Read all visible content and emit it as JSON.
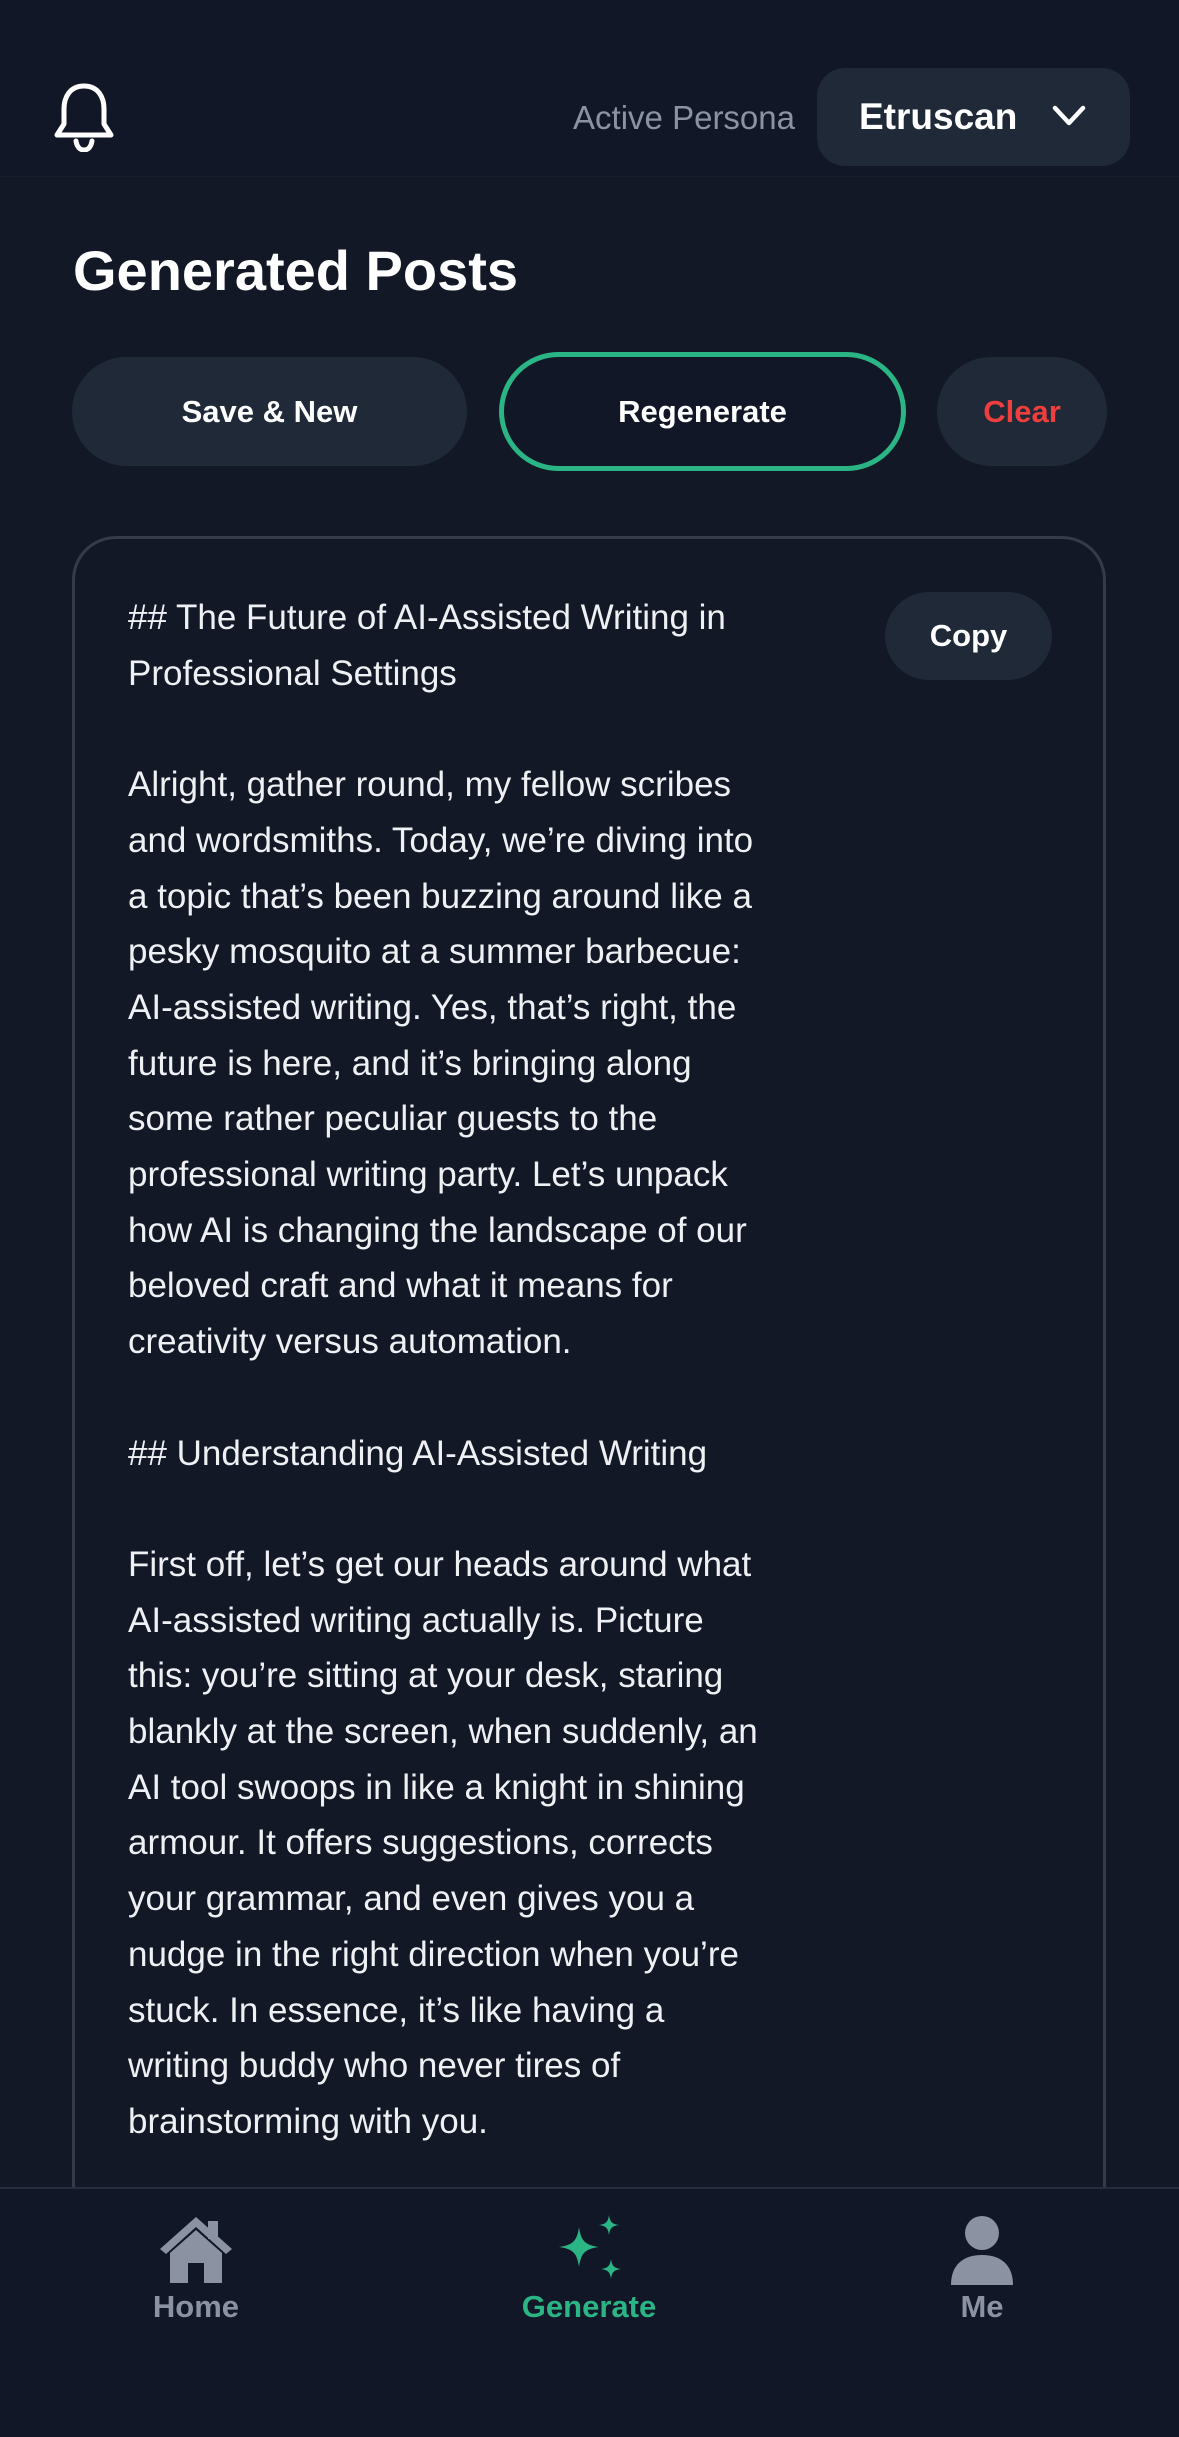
{
  "header": {
    "persona_label": "Active Persona",
    "persona_value": "Etruscan"
  },
  "page": {
    "title": "Generated Posts"
  },
  "actions": {
    "save_new": "Save & New",
    "regenerate": "Regenerate",
    "clear": "Clear"
  },
  "post": {
    "copy_label": "Copy",
    "body": "## The Future of AI-Assisted Writing in\nProfessional Settings\n\nAlright, gather round, my fellow scribes\nand wordsmiths. Today, we’re diving into\na topic that’s been buzzing around like a\npesky mosquito at a summer barbecue:\nAI-assisted writing. Yes, that’s right, the\nfuture is here, and it’s bringing along\nsome rather peculiar guests to the\nprofessional writing party. Let’s unpack\nhow AI is changing the landscape of our\nbeloved craft and what it means for\ncreativity versus automation.\n\n## Understanding AI-Assisted Writing\n\nFirst off, let’s get our heads around what\nAI-assisted writing actually is. Picture\nthis: you’re sitting at your desk, staring\nblankly at the screen, when suddenly, an\nAI tool swoops in like a knight in shining\narmour. It offers suggestions, corrects\nyour grammar, and even gives you a\nnudge in the right direction when you’re\nstuck. In essence, it’s like having a\nwriting buddy who never tires of\nbrainstorming with you."
  },
  "nav": {
    "home": "Home",
    "generate": "Generate",
    "me": "Me",
    "active": "generate"
  },
  "colors": {
    "background": "#121826",
    "surface": "#1f2937",
    "accent": "#2bb585",
    "danger": "#ef3e3e",
    "muted": "#8b93a3"
  }
}
